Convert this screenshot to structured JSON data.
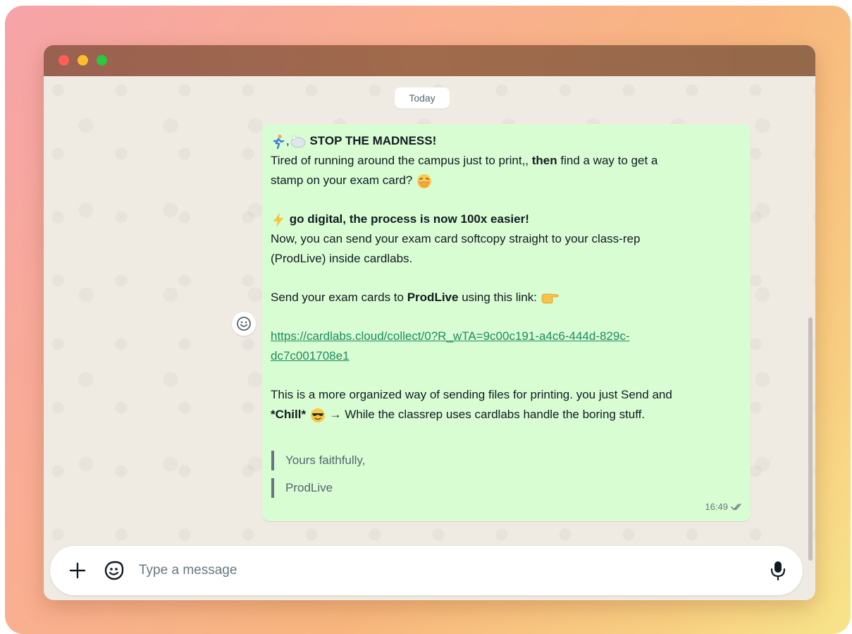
{
  "chat": {
    "date_separator": "Today"
  },
  "message": {
    "line1_title": "STOP THE MADNESS!",
    "line2_pre": "Tired of running around the campus just to print,, ",
    "line2_bold": "then",
    "line2_post": " find a way to get a",
    "line3": "stamp on your exam card?",
    "digital_title": "go digital, the process is now 100x easier!",
    "body1": "Now, you can send your exam card softcopy straight to your class-rep",
    "body2": "(ProdLive) inside cardlabs.",
    "send_pre": "Send your exam cards to ",
    "send_bold": "ProdLive",
    "send_post": " using this link:",
    "link_line1": "https://cardlabs.cloud/collect/0?R_wTA=9c00c191-a4c6-444d-829c-",
    "link_line2": "dc7c001708e1",
    "closing1": "This is a more organized way of sending files for printing. you just Send and",
    "closing2_bold": "*Chill*",
    "closing2_post": " → While the classrep uses cardlabs handle the boring stuff.",
    "quote1": "Yours faithfully,",
    "quote2": "ProdLive",
    "time": "16:49"
  },
  "composer": {
    "placeholder": "Type a message"
  },
  "icons": {
    "runner": "runner-icon",
    "soap": "soap-icon",
    "lightning": "lightning-icon",
    "pointing": "pointing-hand-icon",
    "shushing": "face-hand-over-mouth-icon",
    "sunglasses": "sunglasses-face-icon",
    "read_receipt": "double-check-icon"
  },
  "colors": {
    "bubble": "#d9fdd3",
    "link": "#1e8a5e",
    "chat_bg": "#efeae2"
  }
}
